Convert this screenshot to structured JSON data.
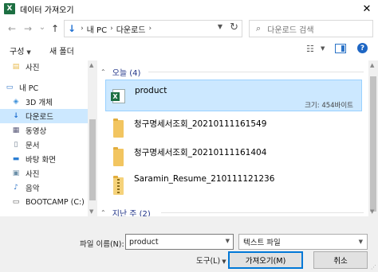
{
  "window": {
    "title": "데이터 가져오기",
    "app_icon_letter": "X",
    "close_glyph": "✕"
  },
  "nav": {
    "back": "←",
    "forward": "→",
    "recent": "⌄",
    "up": "↑",
    "breadcrumb": [
      "내 PC",
      "다운로드"
    ],
    "crumb_sep": "›",
    "search_placeholder": "다운로드 검색"
  },
  "toolbar": {
    "organize": "구성",
    "new_folder": "새 폴더"
  },
  "sidebar": {
    "items": [
      {
        "label": "사진",
        "icon": "pictures-icon",
        "glyph": "▤",
        "color": "#e7b84a"
      },
      {
        "label": "내 PC",
        "icon": "pc-icon",
        "glyph": "▭",
        "color": "#2b73c7"
      },
      {
        "label": "3D 개체",
        "icon": "3d-objects-icon",
        "glyph": "◈",
        "color": "#3a8fd9"
      },
      {
        "label": "다운로드",
        "icon": "download-icon",
        "glyph": "↓",
        "color": "#1f6fd1",
        "selected": true
      },
      {
        "label": "동영상",
        "icon": "videos-icon",
        "glyph": "▦",
        "color": "#5a5a7a"
      },
      {
        "label": "문서",
        "icon": "documents-icon",
        "glyph": "▯",
        "color": "#6b7b8c"
      },
      {
        "label": "바탕 화면",
        "icon": "desktop-icon",
        "glyph": "▬",
        "color": "#2b7fd4"
      },
      {
        "label": "사진",
        "icon": "pictures-icon",
        "glyph": "▣",
        "color": "#6c8fa8"
      },
      {
        "label": "음악",
        "icon": "music-icon",
        "glyph": "♪",
        "color": "#2b73c7"
      },
      {
        "label": "BOOTCAMP (C:)",
        "icon": "drive-icon",
        "glyph": "▭",
        "color": "#555555"
      }
    ]
  },
  "content": {
    "groups": [
      {
        "label": "오늘 (4)"
      },
      {
        "label": "지난 주 (2)"
      }
    ],
    "files": [
      {
        "name": "product",
        "type": "excel",
        "meta": "크기: 454바이트",
        "selected": true
      },
      {
        "name": "청구명세서조회_20210111161549",
        "type": "folder"
      },
      {
        "name": "청구명세서조회_20210111161404",
        "type": "folder"
      },
      {
        "name": "Saramin_Resume_210111121236",
        "type": "zip"
      }
    ]
  },
  "bottom": {
    "filename_label": "파일 이름(N):",
    "filename_value": "product",
    "filetype_value": "텍스트 파일",
    "tools_label": "도구(L)",
    "open_label": "가져오기(M)",
    "cancel_label": "취소"
  },
  "colors": {
    "selection": "#cce8ff",
    "accent": "#0078d7",
    "excel_green": "#1d6f42",
    "folder": "#f2c560"
  }
}
